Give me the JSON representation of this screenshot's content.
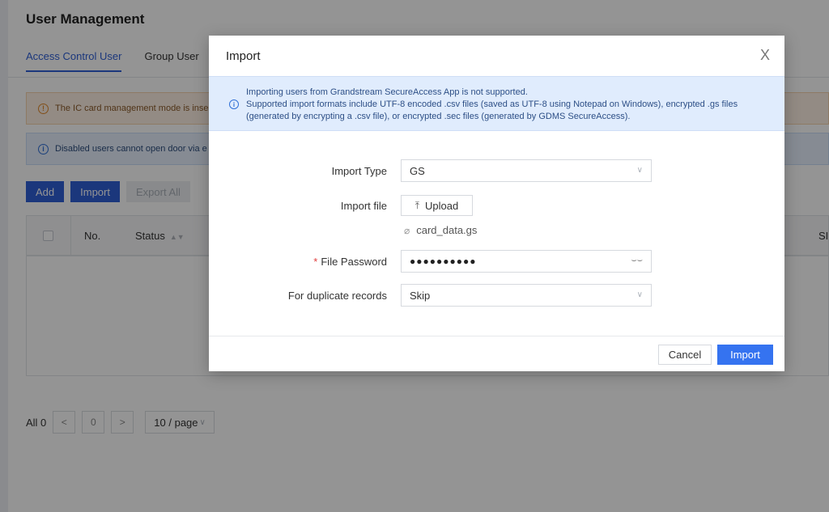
{
  "page": {
    "title": "User Management",
    "tabs": [
      {
        "label": "Access Control User",
        "active": true
      },
      {
        "label": "Group User",
        "active": false
      }
    ],
    "alerts": {
      "warning": "The IC card management mode is inse",
      "info": "Disabled users cannot open door via e"
    },
    "toolbar": {
      "add": "Add",
      "import": "Import",
      "export_all": "Export All"
    },
    "table": {
      "columns": [
        "No.",
        "Status"
      ],
      "right_fragment": "SI"
    },
    "pager": {
      "total": "All 0",
      "prev": "<",
      "page": "0",
      "next": ">",
      "page_size": "10 / page"
    }
  },
  "modal": {
    "title": "Import",
    "close": "X",
    "notice_lines": [
      "Importing users from Grandstream SecureAccess App is not supported.",
      "Supported import formats include UTF-8 encoded .csv files (saved as UTF-8 using Notepad on Windows), encrypted .gs files",
      "(generated by encrypting a .csv file), or encrypted .sec files (generated by GDMS SecureAccess)."
    ],
    "form": {
      "import_type": {
        "label": "Import Type",
        "value": "GS"
      },
      "import_file": {
        "label": "Import file",
        "button": "Upload",
        "file_name": "card_data.gs"
      },
      "file_password": {
        "label": "File Password",
        "required_mark": "*",
        "value": "●●●●●●●●●●"
      },
      "duplicate": {
        "label": "For duplicate records",
        "value": "Skip"
      }
    },
    "footer": {
      "cancel": "Cancel",
      "import": "Import"
    }
  },
  "colors": {
    "primary": "#2f5fd6",
    "modal_primary": "#3573f0",
    "notice_bg": "#e0ecfd"
  }
}
